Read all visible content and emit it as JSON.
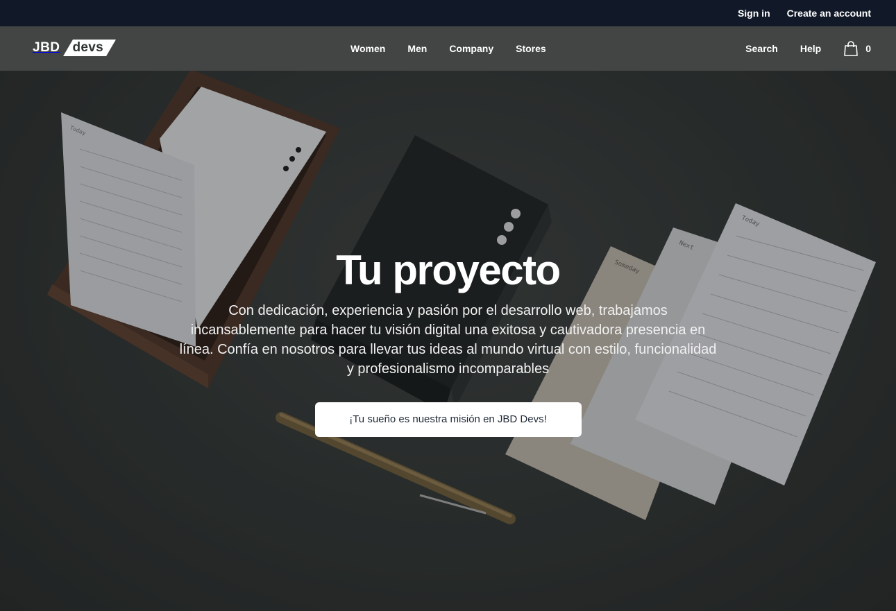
{
  "topbar": {
    "sign_in": "Sign in",
    "create_account": "Create an account"
  },
  "brand": {
    "logo_left": "JBD",
    "logo_right": "devs"
  },
  "nav": {
    "items": [
      "Women",
      "Men",
      "Company",
      "Stores"
    ],
    "search": "Search",
    "help": "Help",
    "cart_count": "0"
  },
  "hero": {
    "title": "Tu proyecto",
    "description": "Con dedicación, experiencia y pasión por el desarrollo web, trabajamos incansablemente para hacer tu visión digital una exitosa y cautivadora presencia en línea. Confía en nosotros para llevar tus ideas al mundo virtual con estilo, funcionalidad y profesionalismo incomparables",
    "cta_label": "¡Tu sueño es nuestra misión en JBD Devs!",
    "card_labels": [
      "Today",
      "Someday",
      "Next",
      "Today"
    ]
  },
  "colors": {
    "topbar_bg": "#111827",
    "nav_bg": "#444746",
    "cta_text": "#1f2937"
  }
}
